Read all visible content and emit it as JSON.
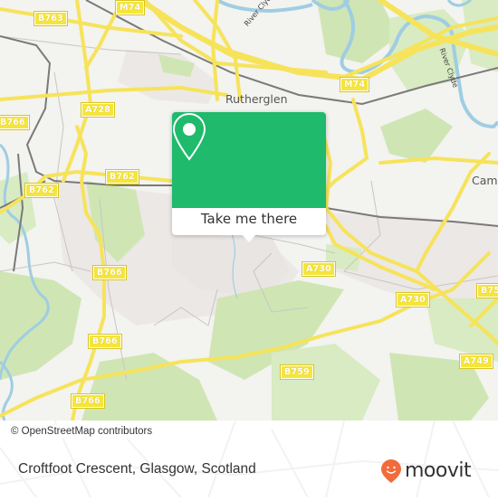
{
  "map": {
    "places": [
      {
        "id": "rutherglen",
        "label": "Rutherglen"
      },
      {
        "id": "cambuslang",
        "label": "Cam"
      }
    ],
    "rivers": [
      {
        "id": "river-clyde-1",
        "label": "River Clyde"
      },
      {
        "id": "river-clyde-2",
        "label": "River Clyde"
      }
    ],
    "road_shields": [
      {
        "id": "b763",
        "label": "B763"
      },
      {
        "id": "m74-top",
        "label": "M74"
      },
      {
        "id": "m74-right",
        "label": "M74"
      },
      {
        "id": "a728",
        "label": "A728"
      },
      {
        "id": "b766-top",
        "label": "B766"
      },
      {
        "id": "b762-mid",
        "label": "B762"
      },
      {
        "id": "b762-left",
        "label": "B762"
      },
      {
        "id": "b766-mid",
        "label": "B766"
      },
      {
        "id": "b766-low",
        "label": "B766"
      },
      {
        "id": "b766-bottom",
        "label": "B766"
      },
      {
        "id": "a730-left",
        "label": "A730"
      },
      {
        "id": "a730-right",
        "label": "A730"
      },
      {
        "id": "b75x",
        "label": "B75"
      },
      {
        "id": "b759",
        "label": "B759"
      },
      {
        "id": "a749",
        "label": "A749"
      }
    ],
    "attribution": "© OpenStreetMap contributors"
  },
  "popup": {
    "icon": "location-pin-icon",
    "button_label": "Take me there",
    "color": "#1fba6c"
  },
  "footer": {
    "address": "Croftfoot Crescent, Glasgow, Scotland",
    "brand": "moovit",
    "brand_color": "#f26b3a"
  }
}
